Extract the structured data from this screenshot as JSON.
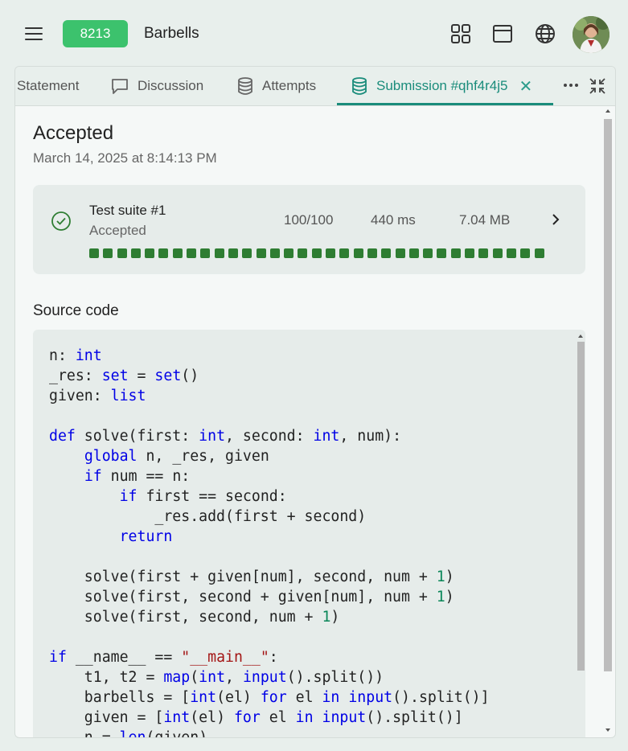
{
  "header": {
    "problem_id": "8213",
    "problem_title": "Barbells",
    "icons": [
      "menu-icon",
      "grid-icon",
      "window-icon",
      "globe-icon",
      "avatar"
    ]
  },
  "tabs": [
    {
      "label": "Statement",
      "icon": "none"
    },
    {
      "label": "Discussion",
      "icon": "chat-icon"
    },
    {
      "label": "Attempts",
      "icon": "database-icon"
    },
    {
      "label": "Submission #qhf4r4j5",
      "icon": "database-icon",
      "active": true
    }
  ],
  "submission": {
    "status": "Accepted",
    "date": "March 14, 2025 at 8:14:13 PM"
  },
  "test_suite": {
    "name": "Test suite #1",
    "status": "Accepted",
    "score": "100/100",
    "time": "440 ms",
    "memory": "7.04 MB",
    "test_count": 33,
    "passed_color": "#2e7d32"
  },
  "source": {
    "label": "Source code",
    "lines": [
      "n: int",
      "_res: set = set()",
      "given: list",
      "",
      "def solve(first: int, second: int, num):",
      "    global n, _res, given",
      "    if num == n:",
      "        if first == second:",
      "            _res.add(first + second)",
      "        return",
      "",
      "    solve(first + given[num], second, num + 1)",
      "    solve(first, second + given[num], num + 1)",
      "    solve(first, second, num + 1)",
      "",
      "if __name__ == \"__main__\":",
      "    t1, t2 = map(int, input().split())",
      "    barbells = [int(el) for el in input().split()]",
      "    given = [int(el) for el in input().split()]",
      "    n = len(given)"
    ]
  },
  "colors": {
    "accent": "#1a8c7b",
    "badge": "#3cc26d",
    "keyword": "#0000e6",
    "number": "#098658",
    "string": "#a31515"
  }
}
